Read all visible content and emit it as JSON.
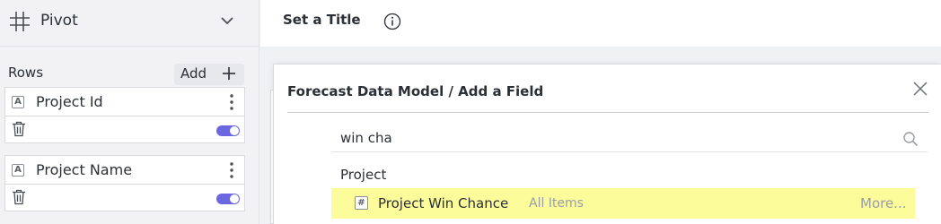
{
  "sidebar": {
    "view_label": "Pivot",
    "view_icon": "grid-icon",
    "rows_label": "Rows",
    "add_label": "Add",
    "rows": [
      {
        "label": "Project Id",
        "type_icon": "A",
        "enabled": true
      },
      {
        "label": "Project Name",
        "type_icon": "A",
        "enabled": true
      }
    ]
  },
  "header": {
    "title": "Set a Title"
  },
  "dialog": {
    "title": "Forecast Data Model / Add a Field",
    "search_value": "win cha",
    "group_label": "Project",
    "results": [
      {
        "type_icon": "#",
        "name": "Project Win Chance",
        "scope": "All Items",
        "more_label": "More..."
      }
    ]
  },
  "colors": {
    "toggle_on": "#6b67e0",
    "highlight": "#fdfc9a"
  }
}
